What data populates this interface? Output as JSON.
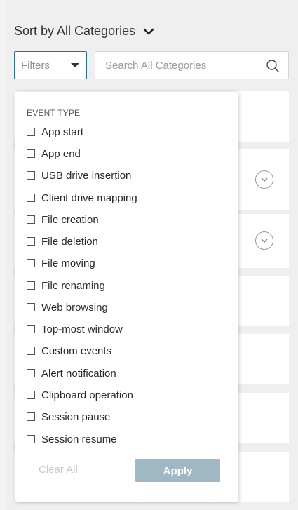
{
  "sort": {
    "label": "Sort by All Categories"
  },
  "filters": {
    "label": "Filters"
  },
  "search": {
    "placeholder": "Search All Categories"
  },
  "dropdown": {
    "section_title": "EVENT TYPE",
    "options": [
      {
        "label": "App start",
        "checked": false
      },
      {
        "label": "App end",
        "checked": false
      },
      {
        "label": "USB drive insertion",
        "checked": false
      },
      {
        "label": "Client drive mapping",
        "checked": false
      },
      {
        "label": "File creation",
        "checked": false
      },
      {
        "label": "File deletion",
        "checked": false
      },
      {
        "label": "File moving",
        "checked": false
      },
      {
        "label": "File renaming",
        "checked": false
      },
      {
        "label": "Web browsing",
        "checked": false
      },
      {
        "label": "Top-most window",
        "checked": false
      },
      {
        "label": "Custom events",
        "checked": false
      },
      {
        "label": "Alert notification",
        "checked": false
      },
      {
        "label": "Clipboard operation",
        "checked": false
      },
      {
        "label": "Session pause",
        "checked": false
      },
      {
        "label": "Session resume",
        "checked": false
      }
    ],
    "clear_label": "Clear All",
    "apply_label": "Apply"
  },
  "colors": {
    "accent_border": "#2d6f9a",
    "apply_bg": "#9fb8c3",
    "panel_bg": "#efefef"
  },
  "icons": {
    "sort": "chevron-down-icon",
    "filters": "caret-down-icon",
    "search": "search-icon",
    "card_expand": "chevron-circle-down-icon"
  }
}
